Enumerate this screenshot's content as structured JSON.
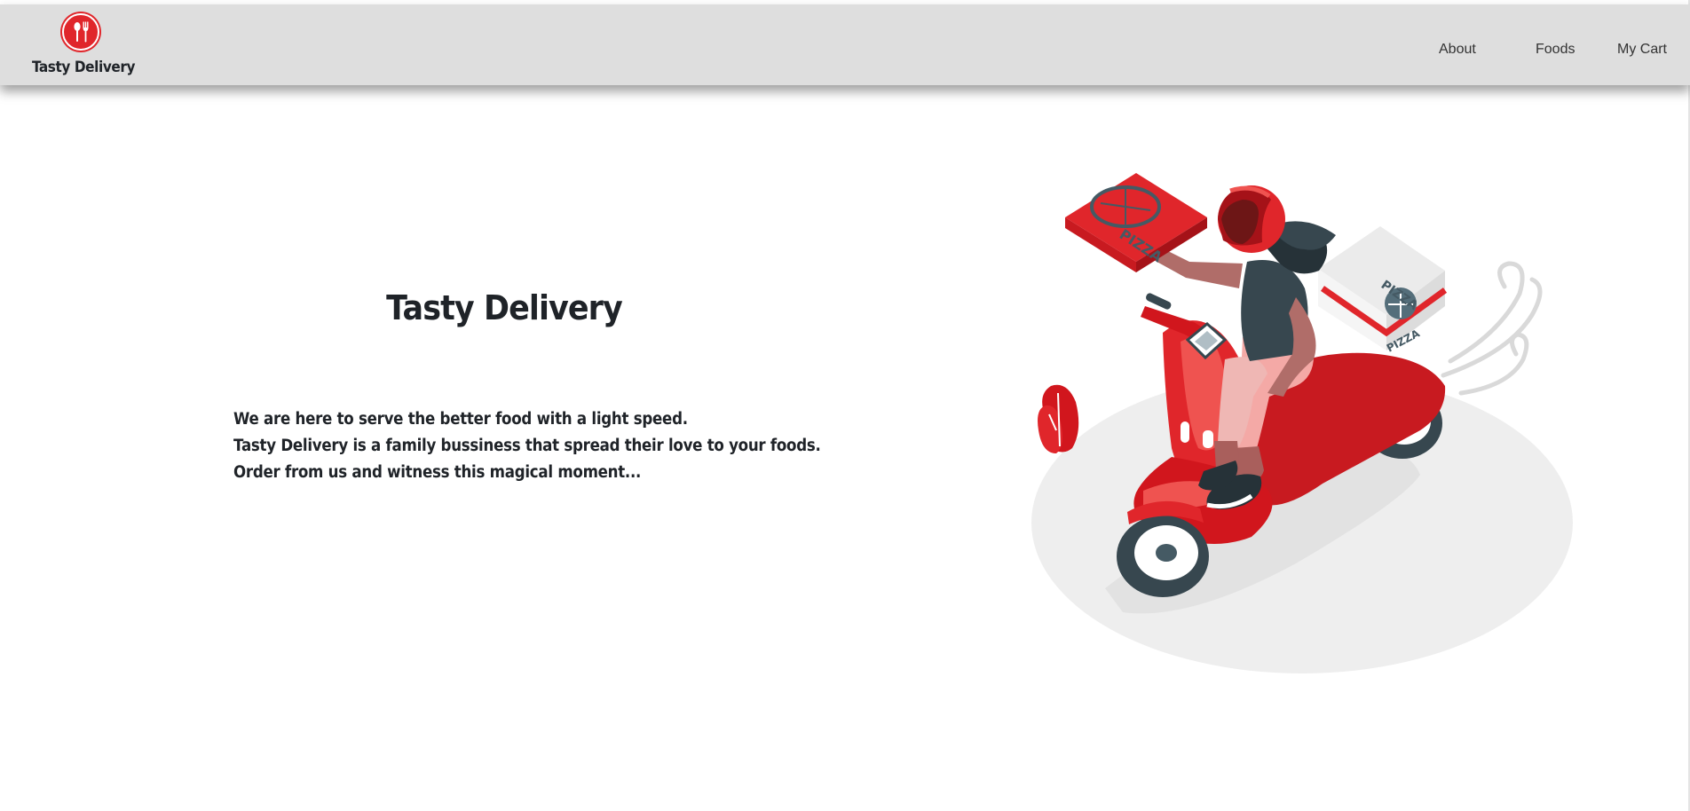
{
  "brand": {
    "name": "Tasty Delivery",
    "logo_icon": "utensils-icon",
    "logo_color": "#e0262b"
  },
  "nav": {
    "about": "About",
    "foods": "Foods",
    "cart": "My Cart"
  },
  "hero": {
    "title": "Tasty Delivery",
    "lines": [
      "We are here to serve the better food with a light speed.",
      "Tasty Delivery is a family bussiness that spread their love to your foods.",
      "Order from us and witness this magical moment..."
    ],
    "illustration": "scooter-pizza-delivery-illustration",
    "pizza_label": "PIZZA"
  },
  "colors": {
    "accent": "#e0262b",
    "navbar_bg": "#dedede",
    "text": "#1f2328"
  }
}
